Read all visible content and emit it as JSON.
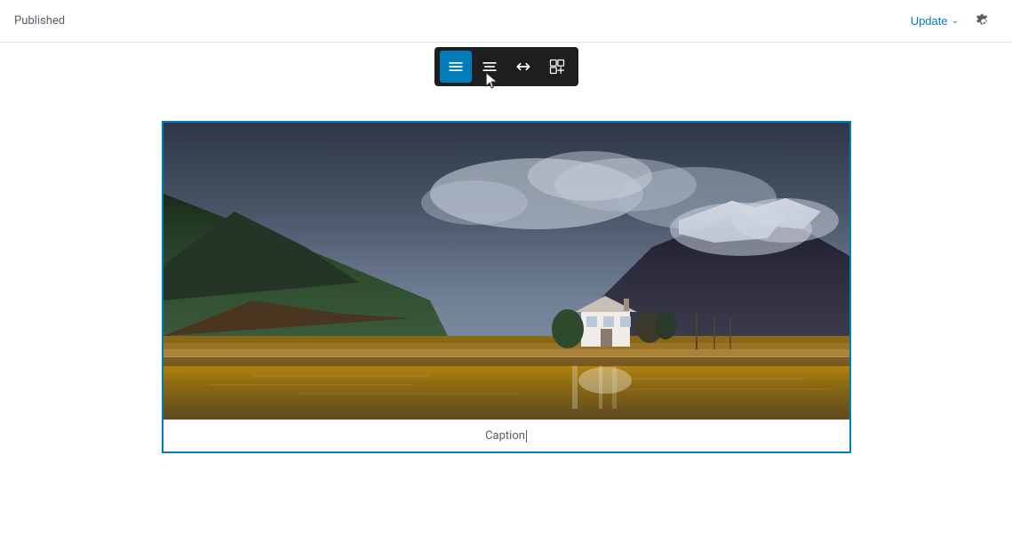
{
  "header": {
    "published_label": "Published",
    "update_button_label": "Update",
    "settings_icon": "gear-icon"
  },
  "toolbar": {
    "buttons": [
      {
        "id": "align-full",
        "icon": "align-full-icon",
        "active": true,
        "symbol": "⬛"
      },
      {
        "id": "align-wide",
        "icon": "align-wide-icon",
        "active": false,
        "symbol": "⬛"
      },
      {
        "id": "resize-icon",
        "icon": "resize-icon",
        "active": false,
        "symbol": "↔"
      },
      {
        "id": "block-options",
        "icon": "block-options-icon",
        "active": false,
        "symbol": "⊞"
      }
    ]
  },
  "image_block": {
    "caption": "Caption"
  }
}
